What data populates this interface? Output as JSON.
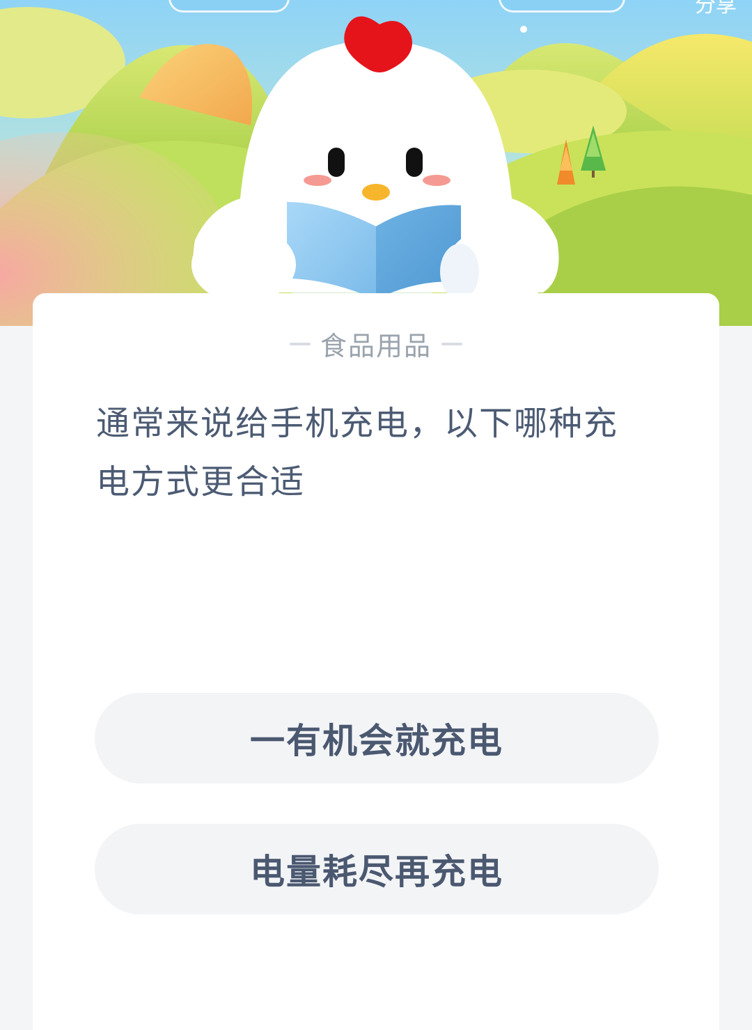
{
  "header": {
    "corner_text": "分享"
  },
  "quiz": {
    "category": "食品用品",
    "question": "通常来说给手机充电，以下哪种充电方式更合适",
    "options": [
      {
        "label": "一有机会就充电"
      },
      {
        "label": "电量耗尽再充电"
      }
    ]
  },
  "colors": {
    "page_bg": "#f4f5f7",
    "card_bg": "#ffffff",
    "question_text": "#4c5b73",
    "option_bg": "#f3f4f6",
    "option_text": "#4a5870",
    "category_text": "#9aa3ad",
    "mascot_comb": "#e5141b",
    "book_blue": "#7fc0ee"
  },
  "icons": {
    "mascot": "chick-mascot-reading-book",
    "scenery": "green-hills-with-trees"
  }
}
